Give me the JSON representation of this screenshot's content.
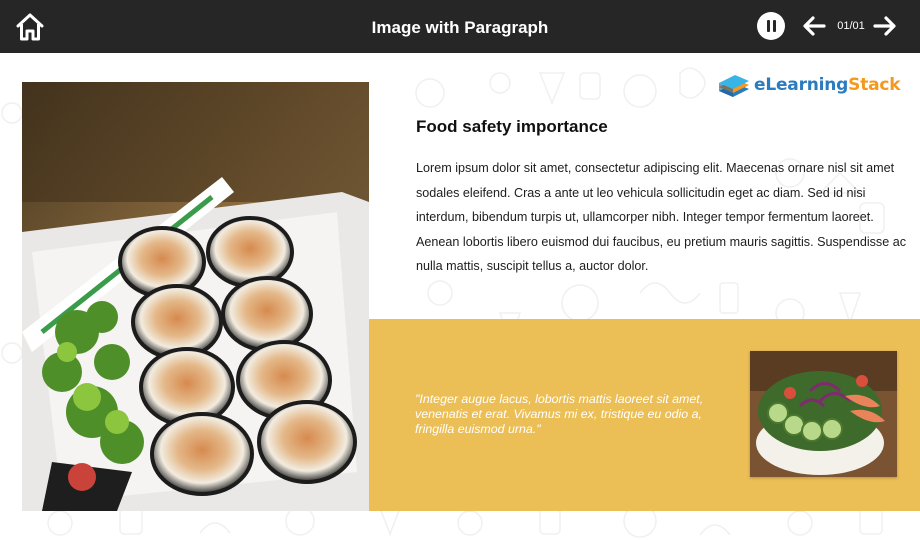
{
  "header": {
    "title": "Image with Paragraph",
    "page_counter": "01/01",
    "home_icon": "home-icon",
    "pause_icon": "pause-icon",
    "prev_icon": "arrow-left-icon",
    "next_icon": "arrow-right-icon"
  },
  "logo": {
    "part1": "eLearning",
    "part2": "Stack"
  },
  "content": {
    "heading": "Food safety importance",
    "paragraph": "Lorem ipsum dolor sit amet, consectetur adipiscing elit. Maecenas ornare nisl sit amet sodales eleifend. Cras a ante ut leo vehicula sollicitudin eget ac diam. Sed id nisi interdum, bibendum turpis ut, ullamcorper nibh. Integer tempor fermentum laoreet. Aenean lobortis libero euismod dui faucibus, eu pretium mauris sagittis. Suspendisse ac nulla mattis, suscipit tellus a, auctor dolor.",
    "quote": "\"Integer augue lacus, lobortis mattis laoreet sit amet, venenatis et erat. Vivamus mi ex, tristique eu odio a, fringilla euismod urna.\""
  },
  "colors": {
    "topbar": "#262626",
    "accent_band": "#ecbe56",
    "logo_blue": "#2b7bc0",
    "logo_orange": "#f39a1e"
  }
}
